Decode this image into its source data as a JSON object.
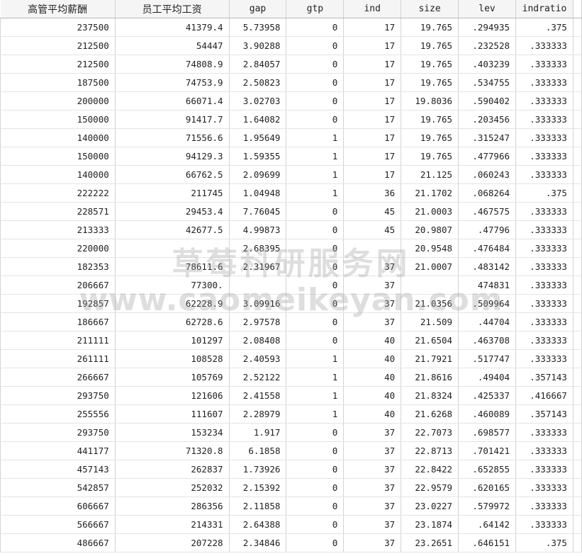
{
  "columns": [
    "高管平均薪酬",
    "员工平均工资",
    "gap",
    "gtp",
    "ind",
    "size",
    "lev",
    "indratio"
  ],
  "rows": [
    [
      "237500",
      "41379.4",
      "5.73958",
      "0",
      "17",
      "19.765",
      ".294935",
      ".375"
    ],
    [
      "212500",
      "54447",
      "3.90288",
      "0",
      "17",
      "19.765",
      ".232528",
      ".333333"
    ],
    [
      "212500",
      "74808.9",
      "2.84057",
      "0",
      "17",
      "19.765",
      ".403239",
      ".333333"
    ],
    [
      "187500",
      "74753.9",
      "2.50823",
      "0",
      "17",
      "19.765",
      ".534755",
      ".333333"
    ],
    [
      "200000",
      "66071.4",
      "3.02703",
      "0",
      "17",
      "19.8036",
      ".590402",
      ".333333"
    ],
    [
      "150000",
      "91417.7",
      "1.64082",
      "0",
      "17",
      "19.765",
      ".203456",
      ".333333"
    ],
    [
      "140000",
      "71556.6",
      "1.95649",
      "1",
      "17",
      "19.765",
      ".315247",
      ".333333"
    ],
    [
      "150000",
      "94129.3",
      "1.59355",
      "1",
      "17",
      "19.765",
      ".477966",
      ".333333"
    ],
    [
      "140000",
      "66762.5",
      "2.09699",
      "1",
      "17",
      "21.125",
      ".060243",
      ".333333"
    ],
    [
      "222222",
      "211745",
      "1.04948",
      "1",
      "36",
      "21.1702",
      ".068264",
      ".375"
    ],
    [
      "228571",
      "29453.4",
      "7.76045",
      "0",
      "45",
      "21.0003",
      ".467575",
      ".333333"
    ],
    [
      "213333",
      "42677.5",
      "4.99873",
      "0",
      "45",
      "20.9807",
      ".47796",
      ".333333"
    ],
    [
      "220000",
      "",
      "2.68395",
      "0",
      "",
      "20.9548",
      ".476484",
      ".333333"
    ],
    [
      "182353",
      "78611.6",
      "2.31967",
      "0",
      "37",
      "21.0007",
      ".483142",
      ".333333"
    ],
    [
      "206667",
      "77300.",
      "",
      "0",
      "37",
      "",
      "474831",
      ".333333"
    ],
    [
      "192857",
      "62228.9",
      "3.09916",
      "0",
      "37",
      "21.0356",
      ".509964",
      ".333333"
    ],
    [
      "186667",
      "62728.6",
      "2.97578",
      "0",
      "37",
      "21.509",
      ".44704",
      ".333333"
    ],
    [
      "211111",
      "101297",
      "2.08408",
      "0",
      "40",
      "21.6504",
      ".463708",
      ".333333"
    ],
    [
      "261111",
      "108528",
      "2.40593",
      "1",
      "40",
      "21.7921",
      ".517747",
      ".333333"
    ],
    [
      "266667",
      "105769",
      "2.52122",
      "1",
      "40",
      "21.8616",
      ".49404",
      ".357143"
    ],
    [
      "293750",
      "121606",
      "2.41558",
      "1",
      "40",
      "21.8324",
      ".425337",
      ".416667"
    ],
    [
      "255556",
      "111607",
      "2.28979",
      "1",
      "40",
      "21.6268",
      ".460089",
      ".357143"
    ],
    [
      "293750",
      "153234",
      "1.917",
      "0",
      "37",
      "22.7073",
      ".698577",
      ".333333"
    ],
    [
      "441177",
      "71320.8",
      "6.1858",
      "0",
      "37",
      "22.8713",
      ".701421",
      ".333333"
    ],
    [
      "457143",
      "262837",
      "1.73926",
      "0",
      "37",
      "22.8422",
      ".652855",
      ".333333"
    ],
    [
      "542857",
      "252032",
      "2.15392",
      "0",
      "37",
      "22.9579",
      ".620165",
      ".333333"
    ],
    [
      "606667",
      "286356",
      "2.11858",
      "0",
      "37",
      "23.0227",
      ".579972",
      ".333333"
    ],
    [
      "566667",
      "214331",
      "2.64388",
      "0",
      "37",
      "23.1874",
      ".64142",
      ".333333"
    ],
    [
      "486667",
      "207228",
      "2.34846",
      "0",
      "37",
      "23.2651",
      ".646151",
      ".375"
    ]
  ],
  "watermark": {
    "line1": "草莓科研服务网",
    "line2": "www.caomeikeyan.com"
  }
}
